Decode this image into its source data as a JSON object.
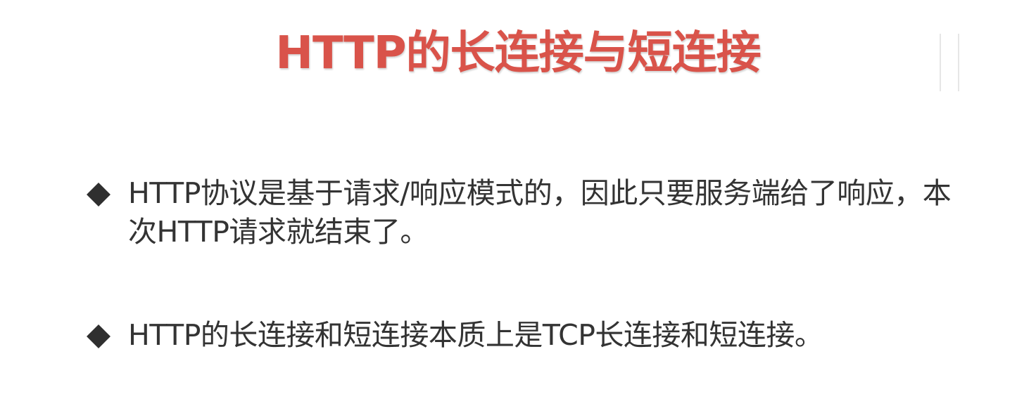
{
  "slide": {
    "title": "HTTP的长连接与短连接",
    "bullets": [
      {
        "text": "HTTP协议是基于请求/响应模式的，因此只要服务端给了响应，本次HTTP请求就结束了。"
      },
      {
        "text": "HTTP的长连接和短连接本质上是TCP长连接和短连接。"
      }
    ]
  },
  "icons": {
    "bullet_marker": "diamond-bullet-icon"
  },
  "colors": {
    "title": "#d9534a",
    "body_text": "#333333",
    "bullet": "#2f2f2f",
    "background": "#ffffff"
  }
}
